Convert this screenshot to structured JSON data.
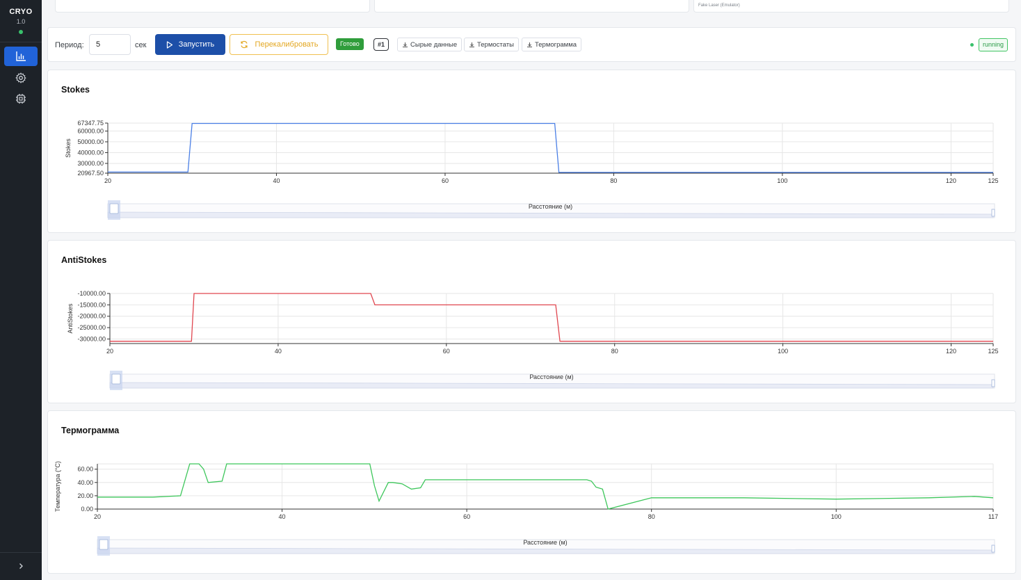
{
  "app": {
    "logo": "CRYO",
    "version": "1.0"
  },
  "sidebar": {
    "items": [
      {
        "icon": "bar-chart-icon",
        "active": true
      },
      {
        "icon": "gear-icon",
        "active": false
      },
      {
        "icon": "chip-icon",
        "active": false
      }
    ],
    "expand_icon": "chevron-right-icon"
  },
  "top_cards": {
    "laser_label": "Fake Laser (Emulator)"
  },
  "toolbar": {
    "period_label": "Период:",
    "period_value": "5",
    "period_unit": "сек",
    "run_label": "Запустить",
    "recalibrate_label": "Перекалибровать",
    "status_badge": "Готово",
    "run_number": "#1",
    "download_raw": "Сырые данные",
    "download_thermostats": "Термостаты",
    "download_thermogram": "Термограмма",
    "state": "running"
  },
  "colors": {
    "accent": "#1d4fa8",
    "stokes": "#4a7fe6",
    "antistokes": "#e0464f",
    "thermogram": "#3cc65a",
    "warning": "#e3a721"
  },
  "chart_data": [
    {
      "type": "line",
      "title": "Stokes",
      "ylabel": "Stokes",
      "xlabel": "Расстояние (м)",
      "xlim": [
        20,
        125
      ],
      "ylim": [
        20967.75,
        67347.75
      ],
      "x_ticks": [
        20,
        40,
        60,
        80,
        100,
        120,
        125
      ],
      "y_ticks": [
        20967.75,
        30000.0,
        40000.0,
        50000.0,
        60000.0,
        67347.75
      ],
      "y_tick_labels": [
        "20967.50",
        "30000.00",
        "40000.00",
        "50000.00",
        "60000.00",
        "67347.75"
      ],
      "series": [
        {
          "x": [
            20,
            29.5,
            30,
            73,
            73.5,
            125
          ],
          "values": [
            22000,
            22000,
            67000,
            67000,
            21700,
            21700
          ]
        }
      ]
    },
    {
      "type": "line",
      "title": "AntiStokes",
      "ylabel": "AntiStokes",
      "xlabel": "Расстояние (м)",
      "xlim": [
        20,
        125
      ],
      "ylim": [
        -32000,
        -10000
      ],
      "x_ticks": [
        20,
        40,
        60,
        80,
        100,
        120,
        125
      ],
      "y_ticks": [
        -30000,
        -25000,
        -20000,
        -15000,
        -10000
      ],
      "y_tick_labels": [
        "-30000.00",
        "-25000.00",
        "-20000.00",
        "-15000.00",
        "-10000.00"
      ],
      "series": [
        {
          "x": [
            20,
            29.7,
            30,
            51,
            51.5,
            73,
            73.5,
            125
          ],
          "values": [
            -31000,
            -31000,
            -10000,
            -10000,
            -15000,
            -15000,
            -31000,
            -31000
          ]
        }
      ]
    },
    {
      "type": "line",
      "title": "Термограмма",
      "ylabel": "Температура (°C)",
      "xlabel": "Расстояние (м)",
      "xlim": [
        20,
        117
      ],
      "ylim": [
        0,
        68
      ],
      "x_ticks": [
        20,
        40,
        60,
        80,
        100,
        117
      ],
      "y_ticks": [
        0,
        20,
        40,
        60
      ],
      "y_tick_labels": [
        "0.00",
        "20.00",
        "40.00",
        "60.00"
      ],
      "series": [
        {
          "x": [
            20,
            26,
            29,
            30,
            31,
            31.5,
            32,
            33.5,
            34,
            49.5,
            50,
            50.5,
            51.5,
            52,
            53,
            54,
            55,
            55.5,
            73,
            73.5,
            74,
            74.7,
            75.3,
            80,
            90,
            100,
            110,
            115,
            117
          ],
          "values": [
            18,
            18,
            20,
            68,
            68,
            60,
            40,
            42,
            68,
            68,
            35,
            12,
            40,
            40,
            38,
            30,
            32,
            44,
            44,
            42,
            33,
            30,
            0,
            17,
            17,
            15,
            17,
            19,
            17
          ]
        }
      ]
    }
  ]
}
